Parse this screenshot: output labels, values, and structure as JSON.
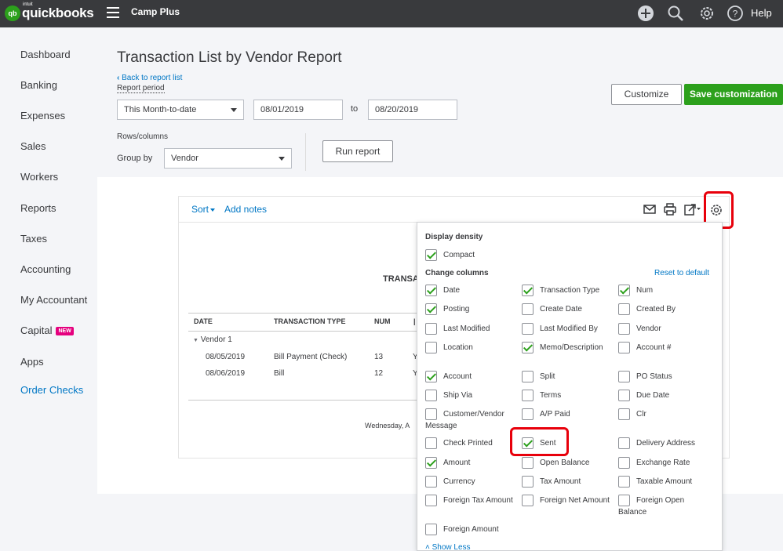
{
  "header": {
    "logo_mark": "qb",
    "logo_intuit": "intuit",
    "logo_text": "quickbooks",
    "company": "Camp Plus",
    "help_label": "Help",
    "icons": [
      "plus-circle-icon",
      "search-icon",
      "gear-icon",
      "help-icon",
      "menu-icon"
    ]
  },
  "sidebar": {
    "items": [
      {
        "label": "Dashboard"
      },
      {
        "label": "Banking"
      },
      {
        "label": "Expenses"
      },
      {
        "label": "Sales"
      },
      {
        "label": "Workers"
      },
      {
        "label": "Reports"
      },
      {
        "label": "Taxes"
      },
      {
        "label": "Accounting"
      },
      {
        "label": "My Accountant"
      },
      {
        "label": "Capital",
        "badge": "NEW"
      },
      {
        "label": "Apps"
      },
      {
        "label": "Order Checks"
      }
    ]
  },
  "page": {
    "title": "Transaction List by Vendor Report",
    "back_link": "Back to report list",
    "report_period_label": "Report period",
    "period_select": "This Month-to-date",
    "from_date": "08/01/2019",
    "to_label": "to",
    "to_date": "08/20/2019",
    "rows_columns_label": "Rows/columns",
    "group_by_label": "Group by",
    "group_by_value": "Vendor",
    "run_report": "Run report",
    "customize": "Customize",
    "save_customization": "Save customization"
  },
  "report": {
    "sort_label": "Sort",
    "add_notes": "Add notes",
    "heading_partial": "TRANSA",
    "columns": [
      "DATE",
      "TRANSACTION TYPE",
      "NUM"
    ],
    "group_label": "Vendor 1",
    "rows": [
      {
        "date": "08/05/2019",
        "type": "Bill Payment (Check)",
        "num": "13",
        "partial": "Y"
      },
      {
        "date": "08/06/2019",
        "type": "Bill",
        "num": "12",
        "partial": "Y"
      }
    ],
    "footer_partial": "Wednesday, A",
    "icons": [
      "email-icon",
      "print-icon",
      "export-icon",
      "settings-gear-icon"
    ]
  },
  "settings_panel": {
    "display_density_label": "Display density",
    "compact": {
      "label": "Compact",
      "checked": true
    },
    "change_columns_label": "Change columns",
    "reset_label": "Reset to default",
    "options": [
      {
        "label": "Date",
        "checked": true
      },
      {
        "label": "Transaction Type",
        "checked": true
      },
      {
        "label": "Num",
        "checked": true
      },
      {
        "label": "Posting",
        "checked": true
      },
      {
        "label": "Create Date",
        "checked": false
      },
      {
        "label": "Created By",
        "checked": false
      },
      {
        "label": "Last Modified",
        "checked": false
      },
      {
        "label": "Last Modified By",
        "checked": false
      },
      {
        "label": "Vendor",
        "checked": false
      },
      {
        "label": "Location",
        "checked": false
      },
      {
        "label": "Memo/Description",
        "checked": true
      },
      {
        "label": "Account #",
        "checked": false
      },
      {
        "label": "Account",
        "checked": true
      },
      {
        "label": "Split",
        "checked": false
      },
      {
        "label": "PO Status",
        "checked": false
      },
      {
        "label": "Ship Via",
        "checked": false
      },
      {
        "label": "Terms",
        "checked": false
      },
      {
        "label": "Due Date",
        "checked": false
      },
      {
        "label": "Customer/Vendor Message",
        "checked": false
      },
      {
        "label": "A/P Paid",
        "checked": false
      },
      {
        "label": "Clr",
        "checked": false
      },
      {
        "label": "Check Printed",
        "checked": false
      },
      {
        "label": "Sent",
        "checked": true
      },
      {
        "label": "Delivery Address",
        "checked": false
      },
      {
        "label": "Amount",
        "checked": true
      },
      {
        "label": "Open Balance",
        "checked": false
      },
      {
        "label": "Exchange Rate",
        "checked": false
      },
      {
        "label": "Currency",
        "checked": false
      },
      {
        "label": "Tax Amount",
        "checked": false
      },
      {
        "label": "Taxable Amount",
        "checked": false
      },
      {
        "label": "Foreign Tax Amount",
        "checked": false
      },
      {
        "label": "Foreign Net Amount",
        "checked": false
      },
      {
        "label": "Foreign Open Balance",
        "checked": false
      },
      {
        "label": "Foreign Amount",
        "checked": false
      }
    ],
    "show_less": "Show Less"
  },
  "colors": {
    "topbar": "#393a3d",
    "brand_green": "#2ca01c",
    "link_blue": "#0077c5",
    "highlight_red": "#e8000b",
    "badge_pink": "#e5007e"
  }
}
